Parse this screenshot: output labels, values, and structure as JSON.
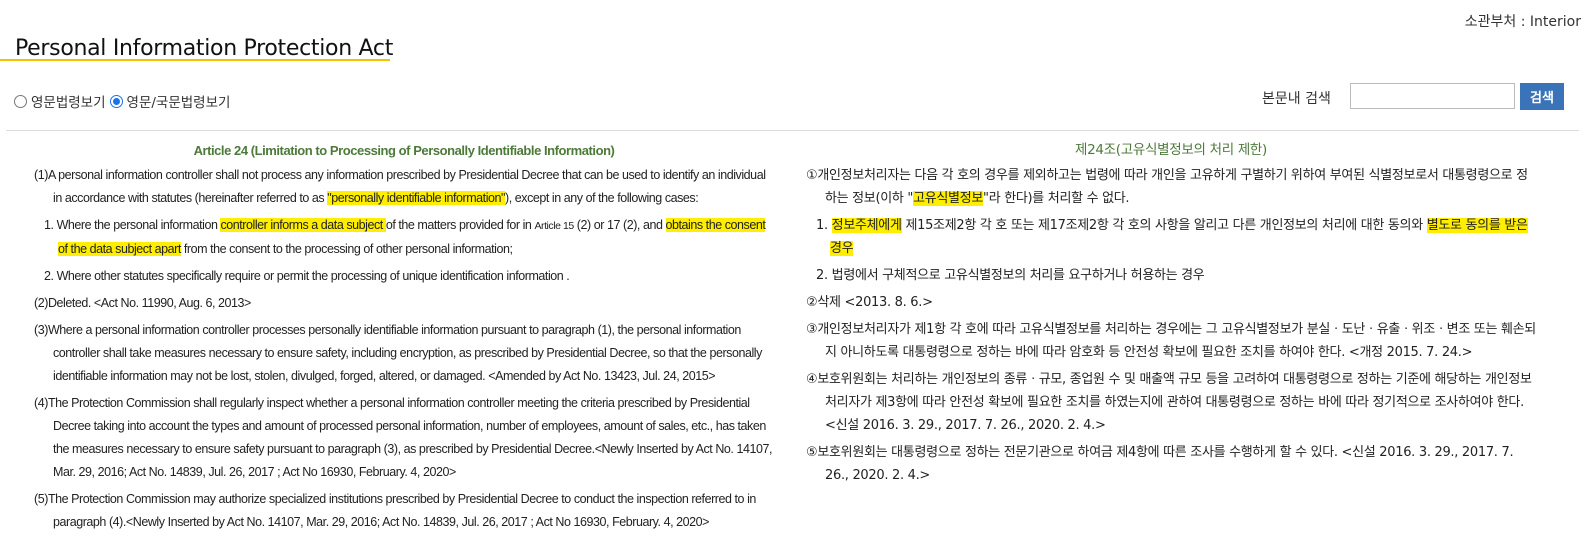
{
  "header": {
    "ministry": "소관부처 : Interior",
    "title": "Personal Information Protection Act"
  },
  "view_options": [
    {
      "label": "영문법령보기",
      "checked": false
    },
    {
      "label": "영문/국문법령보기",
      "checked": true
    }
  ],
  "search": {
    "label": "본문내 검색",
    "value": "",
    "button": "검색"
  },
  "colors": {
    "accent": "#f2c300",
    "highlight": "#ffee00",
    "article_title": "#4d7a3a",
    "search_button": "#3a73b8"
  },
  "english": {
    "title": "Article 24 (Limitation to Processing of Personally Identifiable Information)",
    "p1": {
      "num": "(1)",
      "a": "A personal information controller shall not process any information prescribed by Presidential Decree that can be used to identify an individual in accordance with statutes (hereinafter referred to as ",
      "hl": "\"personally identifiable information\"",
      "b": "), except in any of the following cases:"
    },
    "item1": {
      "num": "1.",
      "a": "Where the personal information ",
      "hl1": "controller informs a data subject ",
      "b": "of the matters provided for in ",
      "ref": "Article 15",
      "c": " (2) or 17 (2), and ",
      "hl2": "obtains the consent of the data subject apart",
      "d": " from the consent to the processing of other personal information;"
    },
    "item2": {
      "num": "2.",
      "text": "Where other statutes specifically require or permit the processing of unique identification information ."
    },
    "p2": {
      "num": "(2)",
      "text": "Deleted. <Act No. 11990, Aug. 6, 2013>"
    },
    "p3": {
      "num": "(3)",
      "text": "Where a personal information controller processes personally identifiable information pursuant to paragraph (1), the personal information controller shall take measures necessary to ensure safety, including encryption, as prescribed by Presidential Decree, so that the personally identifiable information may not be lost, stolen, divulged, forged, altered, or damaged. <Amended by Act No. 13423, Jul. 24, 2015>"
    },
    "p4": {
      "num": "(4)",
      "text": "The Protection Commission shall regularly inspect whether a personal information controller meeting the criteria prescribed by Presidential Decree taking into account the types and amount of processed personal information, number of employees, amount of sales, etc., has taken the measures necessary to ensure safety pursuant to paragraph (3), as prescribed by Presidential Decree.<Newly Inserted by Act No. 14107, Mar. 29, 2016; Act No. 14839, Jul. 26, 2017 ; Act No 16930, February. 4, 2020>"
    },
    "p5": {
      "num": "(5)",
      "text": "The Protection Commission may authorize specialized institutions prescribed by Presidential Decree to conduct the inspection referred to in paragraph (4).<Newly Inserted by Act No. 14107, Mar. 29, 2016; Act No. 14839, Jul. 26, 2017 ; Act No 16930, February. 4, 2020>"
    }
  },
  "korean": {
    "title": "제24조(고유식별정보의 처리 제한)",
    "p1": {
      "num": "①",
      "a": "개인정보처리자는 다음 각 호의 경우를 제외하고는 법령에 따라 개인을 고유하게 구별하기 위하여 부여된 식별정보로서 대통령령으로 정하는 정보(이하 \"",
      "hl": "고유식별정보",
      "b": "\"라 한다)를 처리할 수 없다."
    },
    "item1": {
      "num": "1.",
      "hl1": "정보주체에게",
      "a": " 제15조제2항 각 호 또는 제17조제2항 각 호의 사항을 알리고 다른 개인정보의 처리에 대한 동의와 ",
      "hl2": "별도로 동의를 받은 경우"
    },
    "item2": {
      "num": "2.",
      "text": "법령에서 구체적으로 고유식별정보의 처리를 요구하거나 허용하는 경우"
    },
    "p2": {
      "num": "②",
      "text": "삭제 <2013. 8. 6.>"
    },
    "p3": {
      "num": "③",
      "text": "개인정보처리자가 제1항 각 호에 따라 고유식별정보를 처리하는 경우에는 그 고유식별정보가 분실ㆍ도난ㆍ유출ㆍ위조ㆍ변조 또는 훼손되지 아니하도록 대통령령으로 정하는 바에 따라 암호화 등 안전성 확보에 필요한 조치를 하여야 한다. <개정 2015. 7. 24.>"
    },
    "p4": {
      "num": "④",
      "text": "보호위원회는 처리하는 개인정보의 종류ㆍ규모, 종업원 수 및 매출액 규모 등을 고려하여 대통령령으로 정하는 기준에 해당하는 개인정보처리자가 제3항에 따라 안전성 확보에 필요한 조치를 하였는지에 관하여 대통령령으로 정하는 바에 따라 정기적으로 조사하여야 한다. <신설 2016. 3. 29., 2017. 7. 26., 2020. 2. 4.>"
    },
    "p5": {
      "num": "⑤",
      "text": "보호위원회는 대통령령으로 정하는 전문기관으로 하여금 제4항에 따른 조사를 수행하게 할 수 있다. <신설 2016. 3. 29., 2017. 7. 26., 2020. 2. 4.>"
    }
  }
}
